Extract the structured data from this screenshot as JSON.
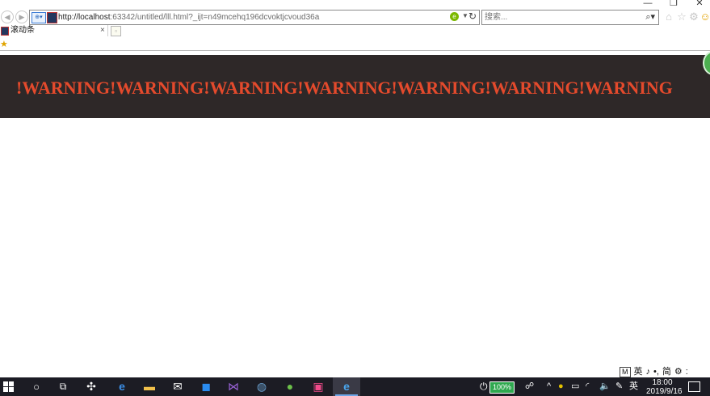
{
  "browser": {
    "window_controls": {
      "minimize": "—",
      "restore": "❐",
      "close": "✕"
    },
    "address": {
      "url_host": "http://localhost",
      "url_rest": ":63342/untitled/lll.html?_ijt=n49mcehq196dcvoktjcvoud36a"
    },
    "search": {
      "placeholder": "搜索...",
      "go_icon": "⌕▾"
    },
    "tab": {
      "title": "滚动条",
      "close": "×"
    }
  },
  "page": {
    "marquee_text": "!WARNING!WARNING!WARNING!WARNING!WARNING!WARNING!WARNING",
    "banner_color": "#2e2828",
    "text_color": "#e44a2c"
  },
  "ime_bar": {
    "items": [
      "M",
      "英",
      "♪",
      "•,",
      "简",
      "⚙",
      ":"
    ]
  },
  "taskbar": {
    "battery_percent": "100%",
    "battery_level": 1.0,
    "input_language": "英",
    "clock_time": "18:00",
    "clock_date": "2019/9/16"
  }
}
